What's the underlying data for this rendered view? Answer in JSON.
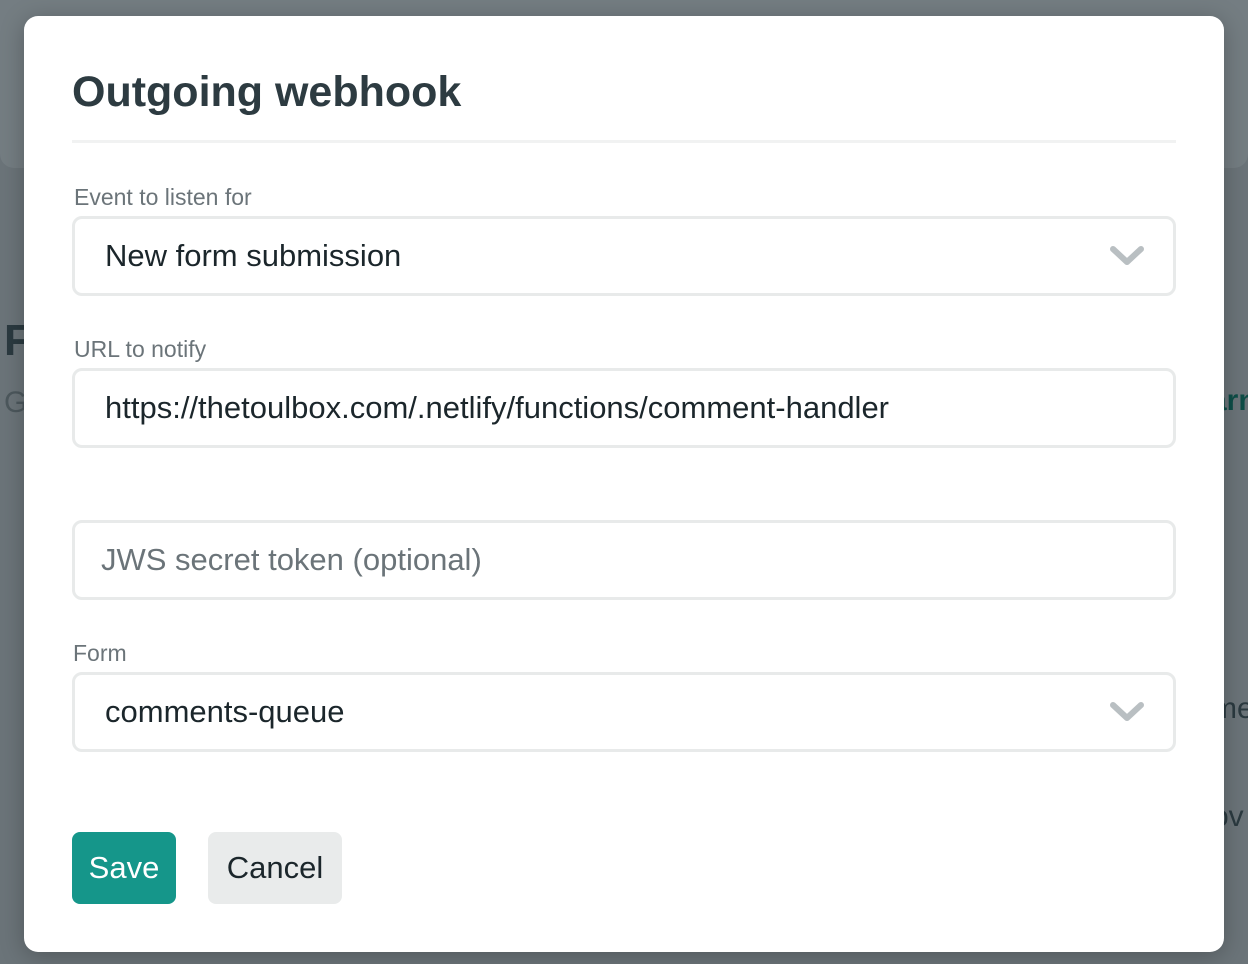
{
  "background": {
    "fragments": [
      "F",
      "G",
      "arn",
      "me",
      "ov"
    ]
  },
  "modal": {
    "title": "Outgoing webhook",
    "event_label": "Event to listen for",
    "event_value": "New form submission",
    "url_label": "URL to notify",
    "url_value": "https://thetoulbox.com/.netlify/functions/comment-handler",
    "token_placeholder": "JWS secret token (optional)",
    "form_label": "Form",
    "form_value": "comments-queue",
    "save_label": "Save",
    "cancel_label": "Cancel"
  },
  "colors": {
    "accent": "#15968a"
  }
}
